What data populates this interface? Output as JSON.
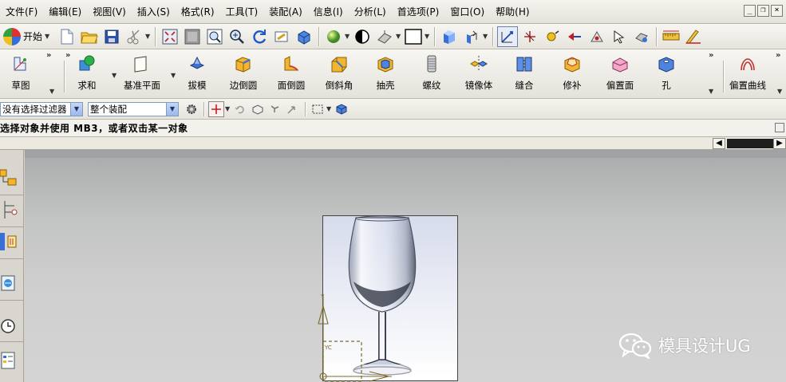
{
  "menubar": {
    "items": [
      {
        "label": "文件(F)"
      },
      {
        "label": "编辑(E)"
      },
      {
        "label": "视图(V)"
      },
      {
        "label": "插入(S)"
      },
      {
        "label": "格式(R)"
      },
      {
        "label": "工具(T)"
      },
      {
        "label": "装配(A)"
      },
      {
        "label": "信息(I)"
      },
      {
        "label": "分析(L)"
      },
      {
        "label": "首选项(P)"
      },
      {
        "label": "窗口(O)"
      },
      {
        "label": "帮助(H)"
      }
    ],
    "window_controls": {
      "minimize": "_",
      "restore": "❐",
      "close": "×"
    }
  },
  "standard_toolbar": {
    "start_label": "开始"
  },
  "feature_toolbar": {
    "items": [
      {
        "label": "草图",
        "icon": "sketch-icon"
      },
      {
        "label": "求和",
        "icon": "unite-icon"
      },
      {
        "label": "基准平面",
        "icon": "datum-plane-icon"
      },
      {
        "label": "拔模",
        "icon": "draft-icon"
      },
      {
        "label": "边倒圆",
        "icon": "edge-blend-icon"
      },
      {
        "label": "面倒圆",
        "icon": "face-blend-icon"
      },
      {
        "label": "倒斜角",
        "icon": "chamfer-icon"
      },
      {
        "label": "抽壳",
        "icon": "shell-icon"
      },
      {
        "label": "螺纹",
        "icon": "thread-icon"
      },
      {
        "label": "镜像体",
        "icon": "mirror-body-icon"
      },
      {
        "label": "缝合",
        "icon": "sew-icon"
      },
      {
        "label": "修补",
        "icon": "patch-icon"
      },
      {
        "label": "偏置面",
        "icon": "offset-face-icon"
      },
      {
        "label": "孔",
        "icon": "hole-icon"
      },
      {
        "label": "偏置曲线",
        "icon": "offset-curve-icon"
      }
    ]
  },
  "selection_bar": {
    "filter_value": "没有选择过滤器",
    "scope_value": "整个装配"
  },
  "cue_line": {
    "text": "选择对象并使用 MB3，或者双击某一对象"
  },
  "watermark": {
    "text": "模具设计UG"
  },
  "colors": {
    "accent": "#3a6fd8",
    "viewport_top": "#a9aaab",
    "viewport_bottom": "#d4d4d4"
  }
}
